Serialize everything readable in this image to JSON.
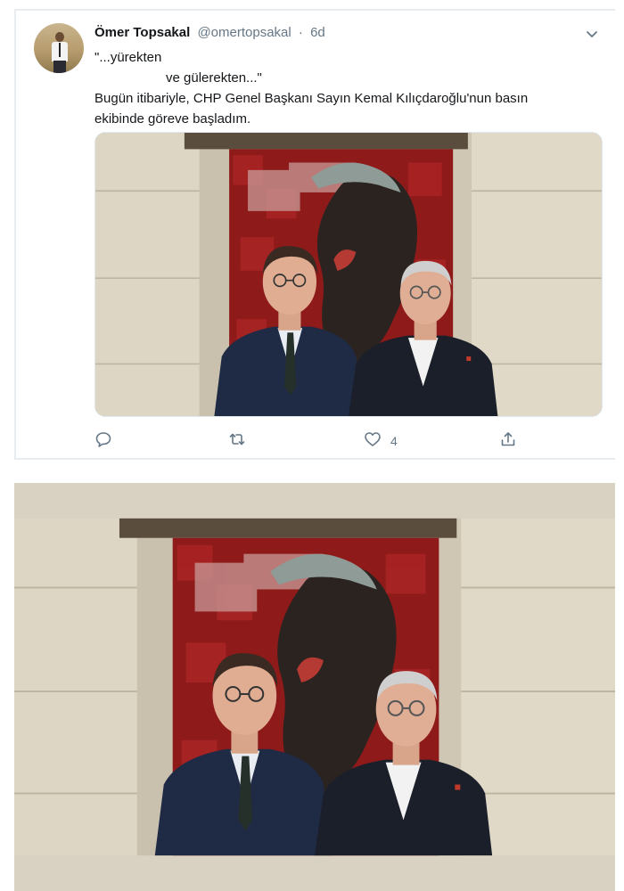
{
  "tweet": {
    "display_name": "Ömer Topsakal",
    "handle": "@omertopsakal",
    "separator": "·",
    "time": "6d",
    "text_lines": [
      "\"...yürekten",
      "ve gülerekten...\"",
      "Bugün itibariyle, CHP Genel Başkanı Sayın Kemal Kılıçdaroğlu'nun basın",
      "ekibinde göreve başladım."
    ],
    "actions": {
      "reply_icon": "reply-icon",
      "retweet_icon": "retweet-icon",
      "like_icon": "heart-icon",
      "like_count": "4",
      "share_icon": "share-icon"
    },
    "menu_icon": "chevron-down-icon"
  },
  "colors": {
    "text": "#14171a",
    "secondary": "#657786",
    "border": "#e6ecf0",
    "mosaic_red": "#9e1c1c"
  }
}
